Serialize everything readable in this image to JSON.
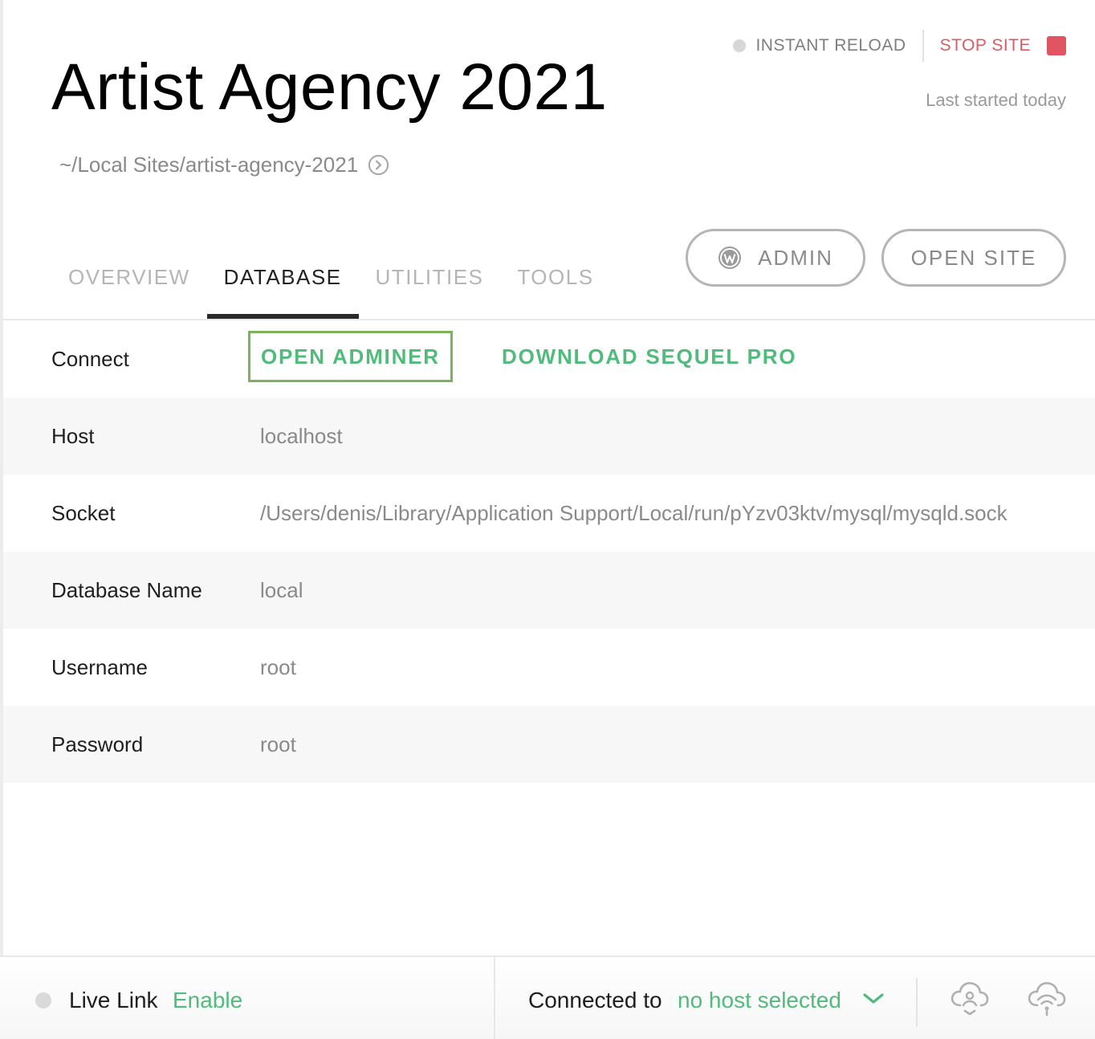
{
  "site": {
    "title": "Artist Agency 2021",
    "path": "~/Local Sites/artist-agency-2021",
    "last_started": "Last started today"
  },
  "status": {
    "instant_reload_label": "INSTANT RELOAD",
    "stop_site_label": "STOP SITE"
  },
  "actions": {
    "admin_label": "ADMIN",
    "open_site_label": "OPEN SITE"
  },
  "tabs": [
    {
      "label": "OVERVIEW",
      "active": false
    },
    {
      "label": "DATABASE",
      "active": true
    },
    {
      "label": "UTILITIES",
      "active": false
    },
    {
      "label": "TOOLS",
      "active": false
    }
  ],
  "database": {
    "connect_label": "Connect",
    "open_adminer": "OPEN ADMINER",
    "download_sequel": "DOWNLOAD SEQUEL PRO",
    "rows": [
      {
        "label": "Host",
        "value": "localhost"
      },
      {
        "label": "Socket",
        "value": "/Users/denis/Library/Application Support/Local/run/pYzv03ktv/mysql/mysqld.sock"
      },
      {
        "label": "Database Name",
        "value": "local"
      },
      {
        "label": "Username",
        "value": "root"
      },
      {
        "label": "Password",
        "value": "root"
      }
    ]
  },
  "footer": {
    "live_link_label": "Live Link",
    "live_link_action": "Enable",
    "connected_label": "Connected to",
    "host_value": "no host selected"
  },
  "colors": {
    "accent_green": "#51bb7b",
    "stop_red": "#e05561",
    "adminer_border": "#7fb35b"
  },
  "icons": [
    "arrow-circle-icon",
    "wordpress-icon",
    "chevron-down-icon",
    "cloud-pull-icon",
    "cloud-push-icon"
  ]
}
